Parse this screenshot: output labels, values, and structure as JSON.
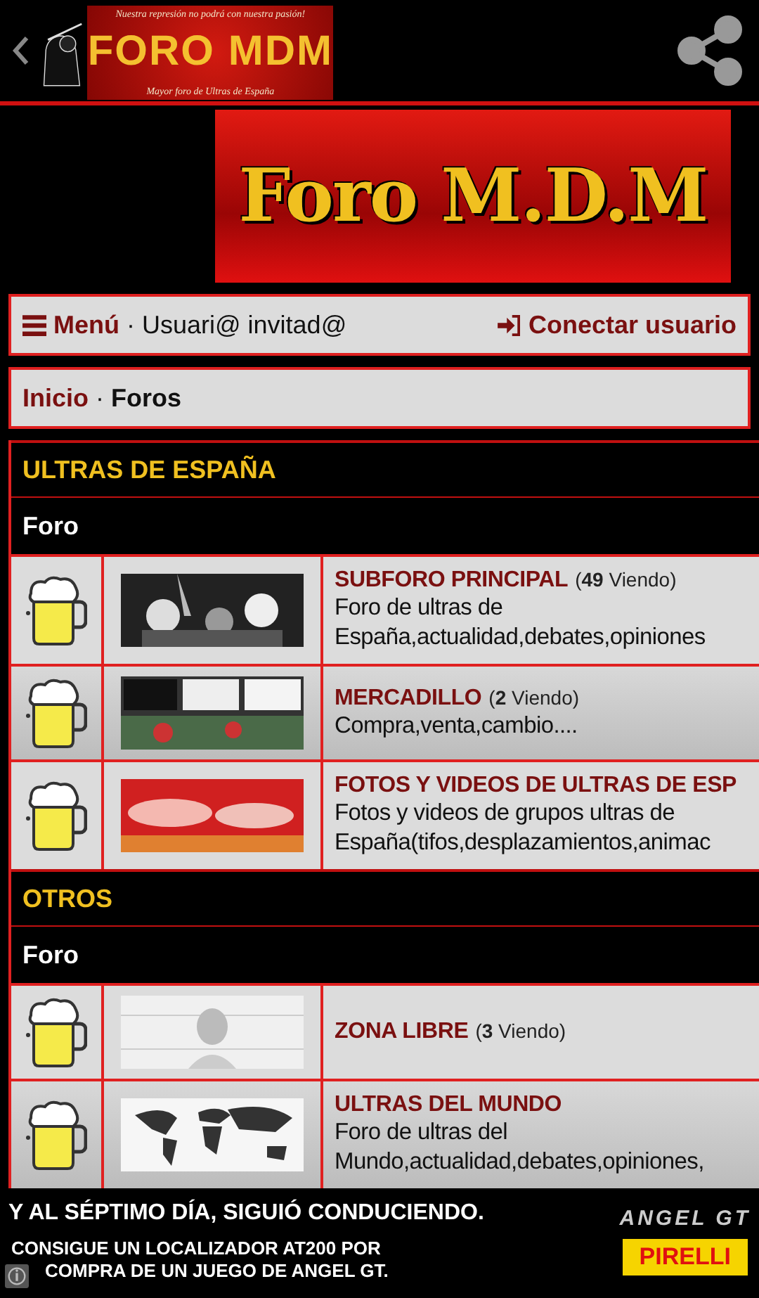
{
  "header": {
    "logo": {
      "top_line": "Nuestra represión no podrá con nuestra pasión!",
      "name": "FORO MDM",
      "tagline": "Mayor foro de Ultras de España"
    }
  },
  "banner": {
    "text": "Foro M.D.M"
  },
  "menu_bar": {
    "menu": "Menú",
    "separator": "·",
    "user": "Usuari@ invitad@",
    "login": "Conectar usuario"
  },
  "breadcrumb": {
    "home": "Inicio",
    "separator": "·",
    "current": "Foros"
  },
  "sections": [
    {
      "title": "ULTRAS DE ESPAÑA",
      "column": "Foro",
      "forums": [
        {
          "title": "SUBFORO PRINCIPAL",
          "viewing": "(**49** Viendo)",
          "lines": [
            "Foro de ultras de",
            "España,actualidad,debates,opiniones"
          ]
        },
        {
          "title": "MERCADILLO",
          "viewing": "(**2** Viendo)",
          "lines": [
            "Compra,venta,cambio...."
          ]
        },
        {
          "title": "FOTOS Y VIDEOS DE ULTRAS DE ESP",
          "lines": [
            "Fotos y videos de grupos ultras de",
            "España(tifos,desplazamientos,animac"
          ]
        }
      ]
    },
    {
      "title": "OTROS",
      "column": "Foro",
      "forums": [
        {
          "title": "ZONA LIBRE",
          "viewing": "(**3** Viendo)"
        },
        {
          "title": "ULTRAS DEL MUNDO",
          "lines": [
            "Foro de ultras del",
            "Mundo,actualidad,debates,opiniones,"
          ]
        }
      ]
    }
  ],
  "ad": {
    "headline": "Y AL SÉPTIMO DÍA, SIGUIÓ CONDUCIENDO.",
    "body": [
      "CONSIGUE UN LOCALIZADOR AT200 POR",
      "COMPRA DE UN JUEGO DE ANGEL GT."
    ],
    "product": "ANGEL GT",
    "brand": "PIRELLI"
  }
}
